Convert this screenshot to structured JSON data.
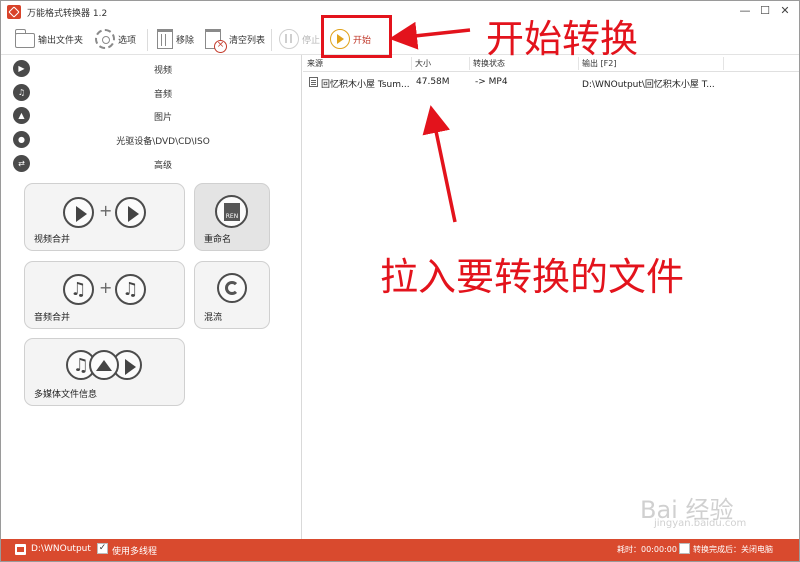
{
  "window": {
    "title": "万能格式转换器 1.2",
    "controls": [
      "—",
      "☐",
      "✕"
    ]
  },
  "toolbar": {
    "output_folder": "输出文件夹",
    "options": "选项",
    "remove": "移除",
    "clear_list": "清空列表",
    "stop": "停止",
    "start": "开始"
  },
  "categories": [
    {
      "label": "视频",
      "icon": "video-icon",
      "glyph": "▶"
    },
    {
      "label": "音频",
      "icon": "audio-icon",
      "glyph": "♫"
    },
    {
      "label": "图片",
      "icon": "image-icon",
      "glyph": "▲"
    },
    {
      "label": "光驱设备\\DVD\\CD\\ISO",
      "icon": "disc-icon",
      "glyph": "●"
    },
    {
      "label": "高级",
      "icon": "advanced-icon",
      "glyph": "⇄"
    }
  ],
  "tiles": {
    "video_merge": "视频合并",
    "rename": "重命名",
    "rename_badge": "REN",
    "audio_merge": "音频合并",
    "remux": "混流",
    "media_info": "多媒体文件信息"
  },
  "file_list": {
    "columns": [
      "来源",
      "大小",
      "转换状态",
      "输出 [F2]"
    ],
    "rows": [
      {
        "source": "回忆积木小屋 Tsum...",
        "size": "47.58M",
        "status": "-> MP4",
        "output": "D:\\WNOutput\\回忆积木小屋 T..."
      }
    ]
  },
  "statusbar": {
    "output_path": "D:\\WNOutput",
    "multithread_label": "使用多线程",
    "multithread_checked": true,
    "elapsed": "耗时：00:00:00",
    "after_convert": "转换完成后：关闭电脑",
    "after_convert_checked": false
  },
  "annotations": {
    "start_note": "开始转换",
    "drag_note": "拉入要转换的文件",
    "color": "#e3131c"
  },
  "watermark": {
    "text": "Bai 经验",
    "sub": "jingyan.baidu.com"
  },
  "colors": {
    "statusbar": "#d94a2e",
    "accent_start": "#e0a21a",
    "annotation": "#e3131c"
  }
}
